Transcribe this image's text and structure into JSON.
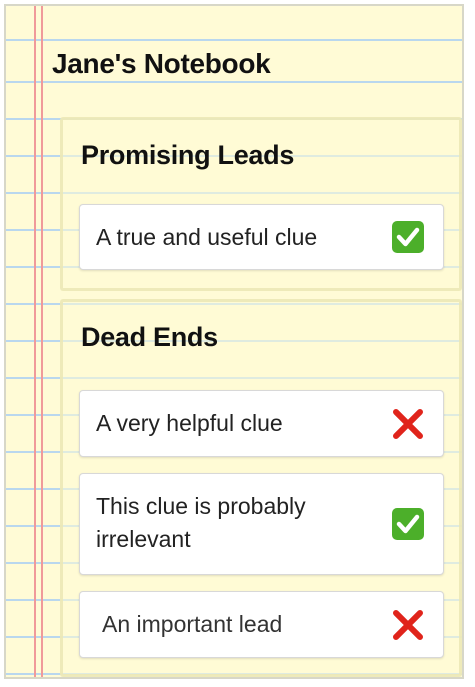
{
  "notebook": {
    "title": "Jane's Notebook"
  },
  "sections": [
    {
      "title": "Promising Leads",
      "cards": [
        {
          "text": "A true and useful clue",
          "status": "check-icon"
        }
      ]
    },
    {
      "title": "Dead Ends",
      "cards": [
        {
          "text": "A very helpful clue",
          "status": "cross-icon"
        },
        {
          "text": "This clue is probably irrelevant",
          "status": "check-icon"
        },
        {
          "text": "An important lead",
          "status": "cross-icon"
        }
      ]
    }
  ],
  "colors": {
    "paper": "#fffbd6",
    "rule_line": "#b9d7ee",
    "margin_line": "#f09a9a",
    "check_green": "#4caf2a",
    "cross_red": "#e0241b"
  }
}
